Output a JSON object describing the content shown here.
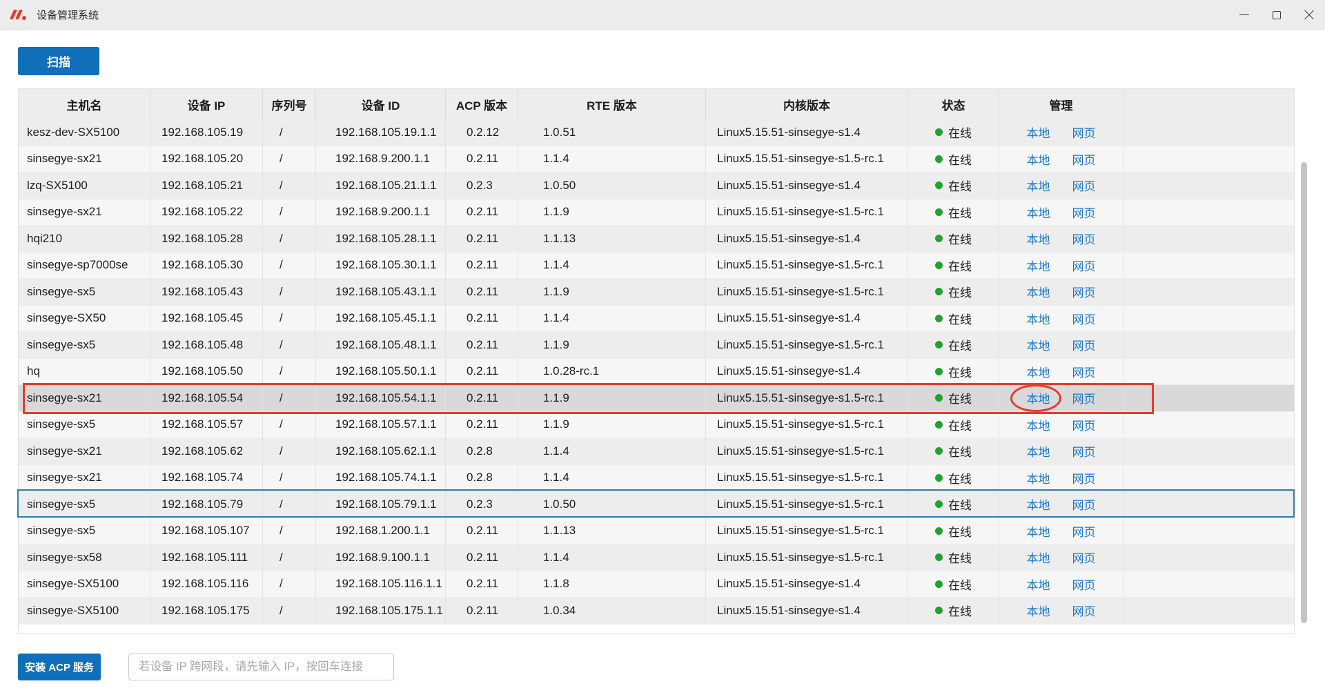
{
  "window": {
    "title": "设备管理系统"
  },
  "toolbar": {
    "scan_label": "扫描"
  },
  "table": {
    "headers": [
      "主机名",
      "设备 IP",
      "序列号",
      "设备 ID",
      "ACP 版本",
      "RTE 版本",
      "内核版本",
      "状态",
      "管理",
      ""
    ],
    "manage_labels": {
      "local": "本地",
      "web": "网页"
    },
    "rows": [
      {
        "hostname": "kesz-dev-SX5100",
        "ip": "192.168.105.19",
        "serial": "/",
        "device_id": "192.168.105.19.1.1",
        "acp": "0.2.12",
        "rte": "1.0.51",
        "kernel": "Linux5.15.51-sinsegye-s1.4",
        "status": "在线",
        "selected": false,
        "outlined": false
      },
      {
        "hostname": "sinsegye-sx21",
        "ip": "192.168.105.20",
        "serial": "/",
        "device_id": "192.168.9.200.1.1",
        "acp": "0.2.11",
        "rte": "1.1.4",
        "kernel": "Linux5.15.51-sinsegye-s1.5-rc.1",
        "status": "在线",
        "selected": false,
        "outlined": false
      },
      {
        "hostname": "lzq-SX5100",
        "ip": "192.168.105.21",
        "serial": "/",
        "device_id": "192.168.105.21.1.1",
        "acp": "0.2.3",
        "rte": "1.0.50",
        "kernel": "Linux5.15.51-sinsegye-s1.4",
        "status": "在线",
        "selected": false,
        "outlined": false
      },
      {
        "hostname": "sinsegye-sx21",
        "ip": "192.168.105.22",
        "serial": "/",
        "device_id": "192.168.9.200.1.1",
        "acp": "0.2.11",
        "rte": "1.1.9",
        "kernel": "Linux5.15.51-sinsegye-s1.5-rc.1",
        "status": "在线",
        "selected": false,
        "outlined": false
      },
      {
        "hostname": "hqi210",
        "ip": "192.168.105.28",
        "serial": "/",
        "device_id": "192.168.105.28.1.1",
        "acp": "0.2.11",
        "rte": "1.1.13",
        "kernel": "Linux5.15.51-sinsegye-s1.4",
        "status": "在线",
        "selected": false,
        "outlined": false
      },
      {
        "hostname": "sinsegye-sp7000se",
        "ip": "192.168.105.30",
        "serial": "/",
        "device_id": "192.168.105.30.1.1",
        "acp": "0.2.11",
        "rte": "1.1.4",
        "kernel": "Linux5.15.51-sinsegye-s1.5-rc.1",
        "status": "在线",
        "selected": false,
        "outlined": false
      },
      {
        "hostname": "sinsegye-sx5",
        "ip": "192.168.105.43",
        "serial": "/",
        "device_id": "192.168.105.43.1.1",
        "acp": "0.2.11",
        "rte": "1.1.9",
        "kernel": "Linux5.15.51-sinsegye-s1.5-rc.1",
        "status": "在线",
        "selected": false,
        "outlined": false
      },
      {
        "hostname": "sinsegye-SX50",
        "ip": "192.168.105.45",
        "serial": "/",
        "device_id": "192.168.105.45.1.1",
        "acp": "0.2.11",
        "rte": "1.1.4",
        "kernel": "Linux5.15.51-sinsegye-s1.4",
        "status": "在线",
        "selected": false,
        "outlined": false
      },
      {
        "hostname": "sinsegye-sx5",
        "ip": "192.168.105.48",
        "serial": "/",
        "device_id": "192.168.105.48.1.1",
        "acp": "0.2.11",
        "rte": "1.1.9",
        "kernel": "Linux5.15.51-sinsegye-s1.5-rc.1",
        "status": "在线",
        "selected": false,
        "outlined": false
      },
      {
        "hostname": "hq",
        "ip": "192.168.105.50",
        "serial": "/",
        "device_id": "192.168.105.50.1.1",
        "acp": "0.2.11",
        "rte": "1.0.28-rc.1",
        "kernel": "Linux5.15.51-sinsegye-s1.4",
        "status": "在线",
        "selected": false,
        "outlined": false
      },
      {
        "hostname": "sinsegye-sx21",
        "ip": "192.168.105.54",
        "serial": "/",
        "device_id": "192.168.105.54.1.1",
        "acp": "0.2.11",
        "rte": "1.1.9",
        "kernel": "Linux5.15.51-sinsegye-s1.5-rc.1",
        "status": "在线",
        "selected": true,
        "outlined": false
      },
      {
        "hostname": "sinsegye-sx5",
        "ip": "192.168.105.57",
        "serial": "/",
        "device_id": "192.168.105.57.1.1",
        "acp": "0.2.11",
        "rte": "1.1.9",
        "kernel": "Linux5.15.51-sinsegye-s1.5-rc.1",
        "status": "在线",
        "selected": false,
        "outlined": false
      },
      {
        "hostname": "sinsegye-sx21",
        "ip": "192.168.105.62",
        "serial": "/",
        "device_id": "192.168.105.62.1.1",
        "acp": "0.2.8",
        "rte": "1.1.4",
        "kernel": "Linux5.15.51-sinsegye-s1.5-rc.1",
        "status": "在线",
        "selected": false,
        "outlined": false
      },
      {
        "hostname": "sinsegye-sx21",
        "ip": "192.168.105.74",
        "serial": "/",
        "device_id": "192.168.105.74.1.1",
        "acp": "0.2.8",
        "rte": "1.1.4",
        "kernel": "Linux5.15.51-sinsegye-s1.5-rc.1",
        "status": "在线",
        "selected": false,
        "outlined": false
      },
      {
        "hostname": "sinsegye-sx5",
        "ip": "192.168.105.79",
        "serial": "/",
        "device_id": "192.168.105.79.1.1",
        "acp": "0.2.3",
        "rte": "1.0.50",
        "kernel": "Linux5.15.51-sinsegye-s1.5-rc.1",
        "status": "在线",
        "selected": false,
        "outlined": true
      },
      {
        "hostname": "sinsegye-sx5",
        "ip": "192.168.105.107",
        "serial": "/",
        "device_id": "192.168.1.200.1.1",
        "acp": "0.2.11",
        "rte": "1.1.13",
        "kernel": "Linux5.15.51-sinsegye-s1.5-rc.1",
        "status": "在线",
        "selected": false,
        "outlined": false
      },
      {
        "hostname": "sinsegye-sx58",
        "ip": "192.168.105.111",
        "serial": "/",
        "device_id": "192.168.9.100.1.1",
        "acp": "0.2.11",
        "rte": "1.1.4",
        "kernel": "Linux5.15.51-sinsegye-s1.5-rc.1",
        "status": "在线",
        "selected": false,
        "outlined": false
      },
      {
        "hostname": "sinsegye-SX5100",
        "ip": "192.168.105.116",
        "serial": "/",
        "device_id": "192.168.105.116.1.1",
        "acp": "0.2.11",
        "rte": "1.1.8",
        "kernel": "Linux5.15.51-sinsegye-s1.4",
        "status": "在线",
        "selected": false,
        "outlined": false
      },
      {
        "hostname": "sinsegye-SX5100",
        "ip": "192.168.105.175",
        "serial": "/",
        "device_id": "192.168.105.175.1.1",
        "acp": "0.2.11",
        "rte": "1.0.34",
        "kernel": "Linux5.15.51-sinsegye-s1.4",
        "status": "在线",
        "selected": false,
        "outlined": false
      }
    ]
  },
  "footer": {
    "install_label": "安装 ACP 服务",
    "ip_placeholder": "若设备 IP 跨网段，请先输入 IP，按回车连接"
  },
  "colors": {
    "accent_blue": "#0f6fb8",
    "link_blue": "#1976d2",
    "online_green": "#1fa32c",
    "annotation_red": "#e43b2e",
    "outline_blue": "#2b7cba",
    "selected_row": "#d9d9d9"
  }
}
